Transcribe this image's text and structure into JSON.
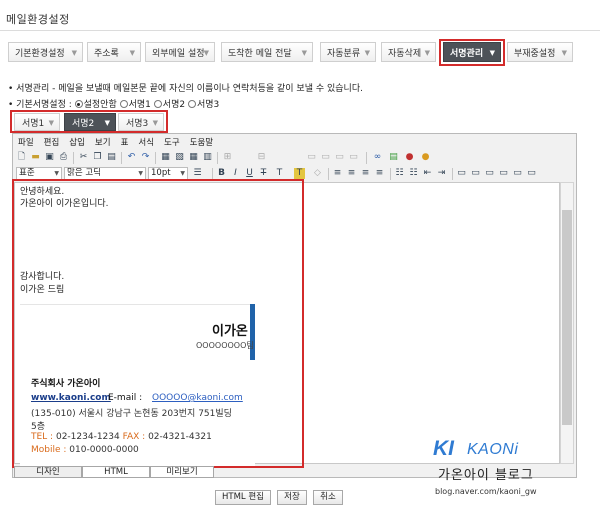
{
  "title": "메일환경설정",
  "main_tabs": [
    {
      "label": "기본환경설정"
    },
    {
      "label": "주소록"
    },
    {
      "label": "외부메일 설정"
    },
    {
      "label": "도착한 메일 전달"
    },
    {
      "label": "자동분류"
    },
    {
      "label": "자동삭제"
    },
    {
      "label": "서명관리"
    },
    {
      "label": "부재중설정"
    }
  ],
  "info_line": "• 서명관리 - 메일을 보낼때 메일본문 끝에 자신의 이름이나 연락처등을 같이 보낼 수 있습니다.",
  "default_sig": {
    "label": "• 기본서명설정 :",
    "options": [
      "설정안함",
      "서명1",
      "서명2",
      "서명3"
    ],
    "selected": "설정안함"
  },
  "sig_tabs": [
    {
      "label": "서명1"
    },
    {
      "label": "서명2"
    },
    {
      "label": "서명3"
    }
  ],
  "menus": [
    "파일",
    "편집",
    "삽입",
    "보기",
    "표",
    "서식",
    "도구",
    "도움말"
  ],
  "format_bar": {
    "style": "표준",
    "font": "맑은 고딕",
    "size": "10pt"
  },
  "body": {
    "line1": "안녕하세요.",
    "line2": "가온아이 이가온입니다.",
    "line3": "감사합니다.",
    "line4": "이가온 드림"
  },
  "card": {
    "name": "이가온",
    "team": "OOOOOOOO팀",
    "company": "주식회사 가온아이",
    "website": "www.kaoni.com",
    "email_label": "E-mail :",
    "email": "OOOOO@kaoni.com",
    "address": "(135-010) 서울시 강남구 논현동 203번지 751빌딩",
    "address2": "5층",
    "tel_label": "TEL :",
    "tel": "02-1234-1234",
    "fax_label": "FAX :",
    "fax": "02-4321-4321",
    "mobile_label": "Mobile :",
    "mobile": "010-0000-0000"
  },
  "bottom_tabs": [
    "디자인",
    "HTML",
    "미리보기"
  ],
  "buttons": {
    "html_edit": "HTML 편집",
    "save": "저장",
    "cancel": "취소"
  },
  "watermark": {
    "ki": "KI",
    "kaoni": "KAONi",
    "blog": "가온아이 블로그",
    "url": "blog.naver.com/kaoni_gw"
  },
  "colors": {
    "highlight_red": "#d32b2b",
    "active_tab": "#4d5258",
    "brand_blue": "#2063a9",
    "accent_orange": "#d96a1b"
  }
}
